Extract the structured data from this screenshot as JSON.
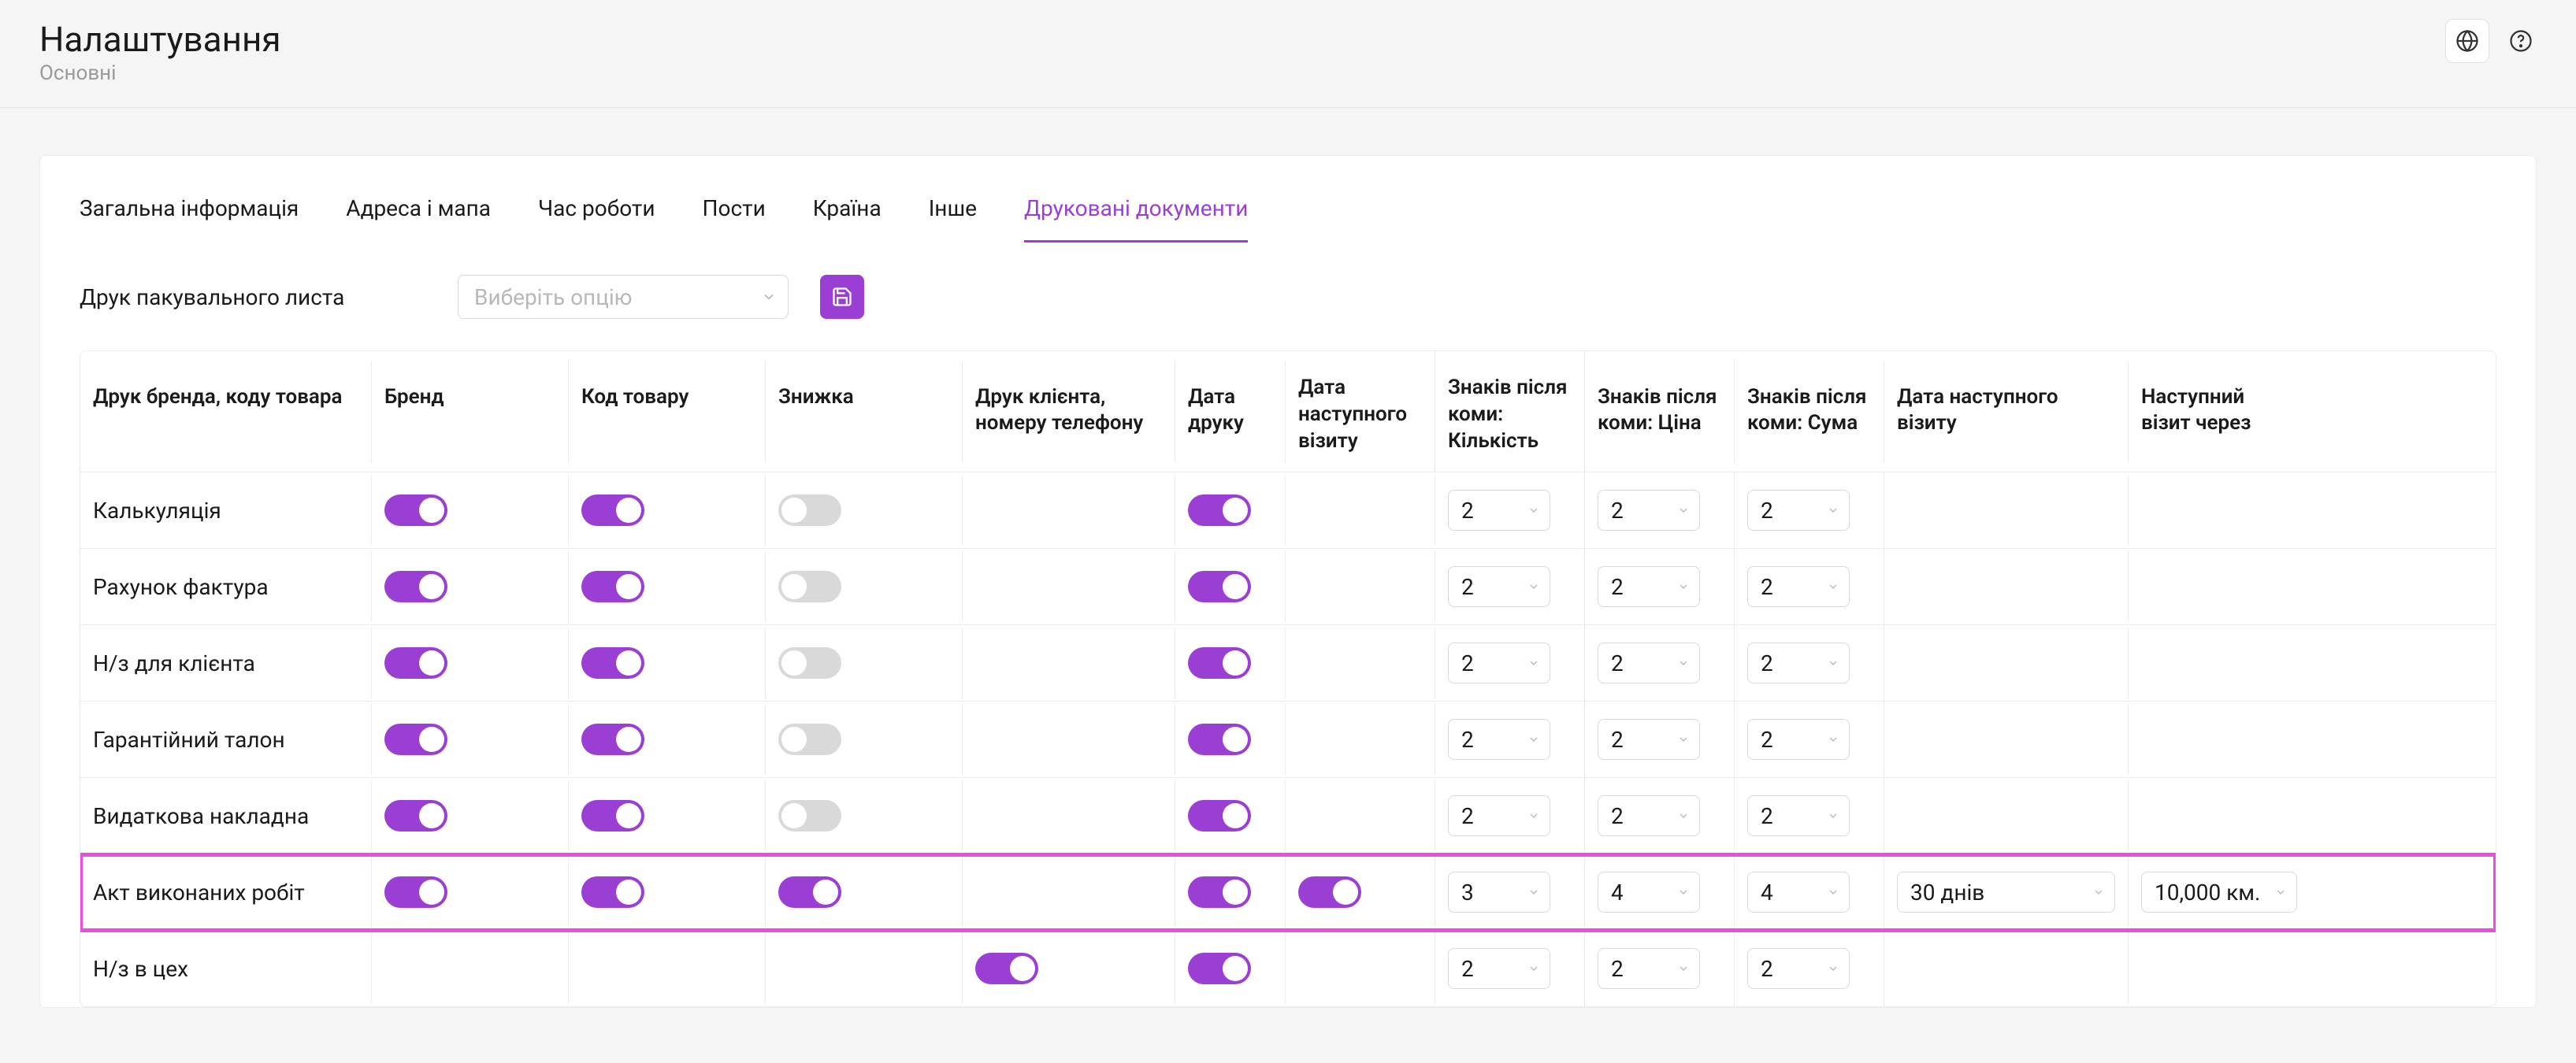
{
  "header": {
    "title": "Налаштування",
    "subtitle": "Основні"
  },
  "tabs": [
    {
      "label": "Загальна інформація",
      "active": false
    },
    {
      "label": "Адреса і мапа",
      "active": false
    },
    {
      "label": "Час роботи",
      "active": false
    },
    {
      "label": "Пости",
      "active": false
    },
    {
      "label": "Країна",
      "active": false
    },
    {
      "label": "Інше",
      "active": false
    },
    {
      "label": "Друковані документи",
      "active": true
    }
  ],
  "packing": {
    "label": "Друк пакувального листа",
    "select_placeholder": "Виберіть опцію"
  },
  "table": {
    "headers": [
      "Друк бренда, коду товара",
      "Бренд",
      "Код товару",
      "Знижка",
      "Друк клієнта, номеру телефону",
      "Дата друку",
      "Дата наступного візиту",
      "Знаків після коми: Кількість",
      "Знаків після коми: Ціна",
      "Знаків після коми: Сума",
      "Дата наступного візиту",
      "Наступний візит через"
    ],
    "rows": [
      {
        "name": "Калькуляція",
        "brand": true,
        "code": true,
        "discount": false,
        "client": null,
        "printdate": true,
        "nextvisit_toggle": null,
        "q": "2",
        "p": "2",
        "s": "2",
        "nv": null,
        "nvthru": null,
        "highlight": false
      },
      {
        "name": "Рахунок фактура",
        "brand": true,
        "code": true,
        "discount": false,
        "client": null,
        "printdate": true,
        "nextvisit_toggle": null,
        "q": "2",
        "p": "2",
        "s": "2",
        "nv": null,
        "nvthru": null,
        "highlight": false
      },
      {
        "name": "Н/з для клієнта",
        "brand": true,
        "code": true,
        "discount": false,
        "client": null,
        "printdate": true,
        "nextvisit_toggle": null,
        "q": "2",
        "p": "2",
        "s": "2",
        "nv": null,
        "nvthru": null,
        "highlight": false
      },
      {
        "name": "Гарантійний талон",
        "brand": true,
        "code": true,
        "discount": false,
        "client": null,
        "printdate": true,
        "nextvisit_toggle": null,
        "q": "2",
        "p": "2",
        "s": "2",
        "nv": null,
        "nvthru": null,
        "highlight": false
      },
      {
        "name": "Видаткова накладна",
        "brand": true,
        "code": true,
        "discount": false,
        "client": null,
        "printdate": true,
        "nextvisit_toggle": null,
        "q": "2",
        "p": "2",
        "s": "2",
        "nv": null,
        "nvthru": null,
        "highlight": false
      },
      {
        "name": "Акт виконаних робіт",
        "brand": true,
        "code": true,
        "discount": true,
        "client": null,
        "printdate": true,
        "nextvisit_toggle": true,
        "q": "3",
        "p": "4",
        "s": "4",
        "nv": "30 днів",
        "nvthru": "10,000 км.",
        "highlight": true
      },
      {
        "name": "Н/з в цех",
        "brand": null,
        "code": null,
        "discount": null,
        "client": true,
        "printdate": true,
        "nextvisit_toggle": null,
        "q": "2",
        "p": "2",
        "s": "2",
        "nv": null,
        "nvthru": null,
        "highlight": false
      }
    ]
  }
}
